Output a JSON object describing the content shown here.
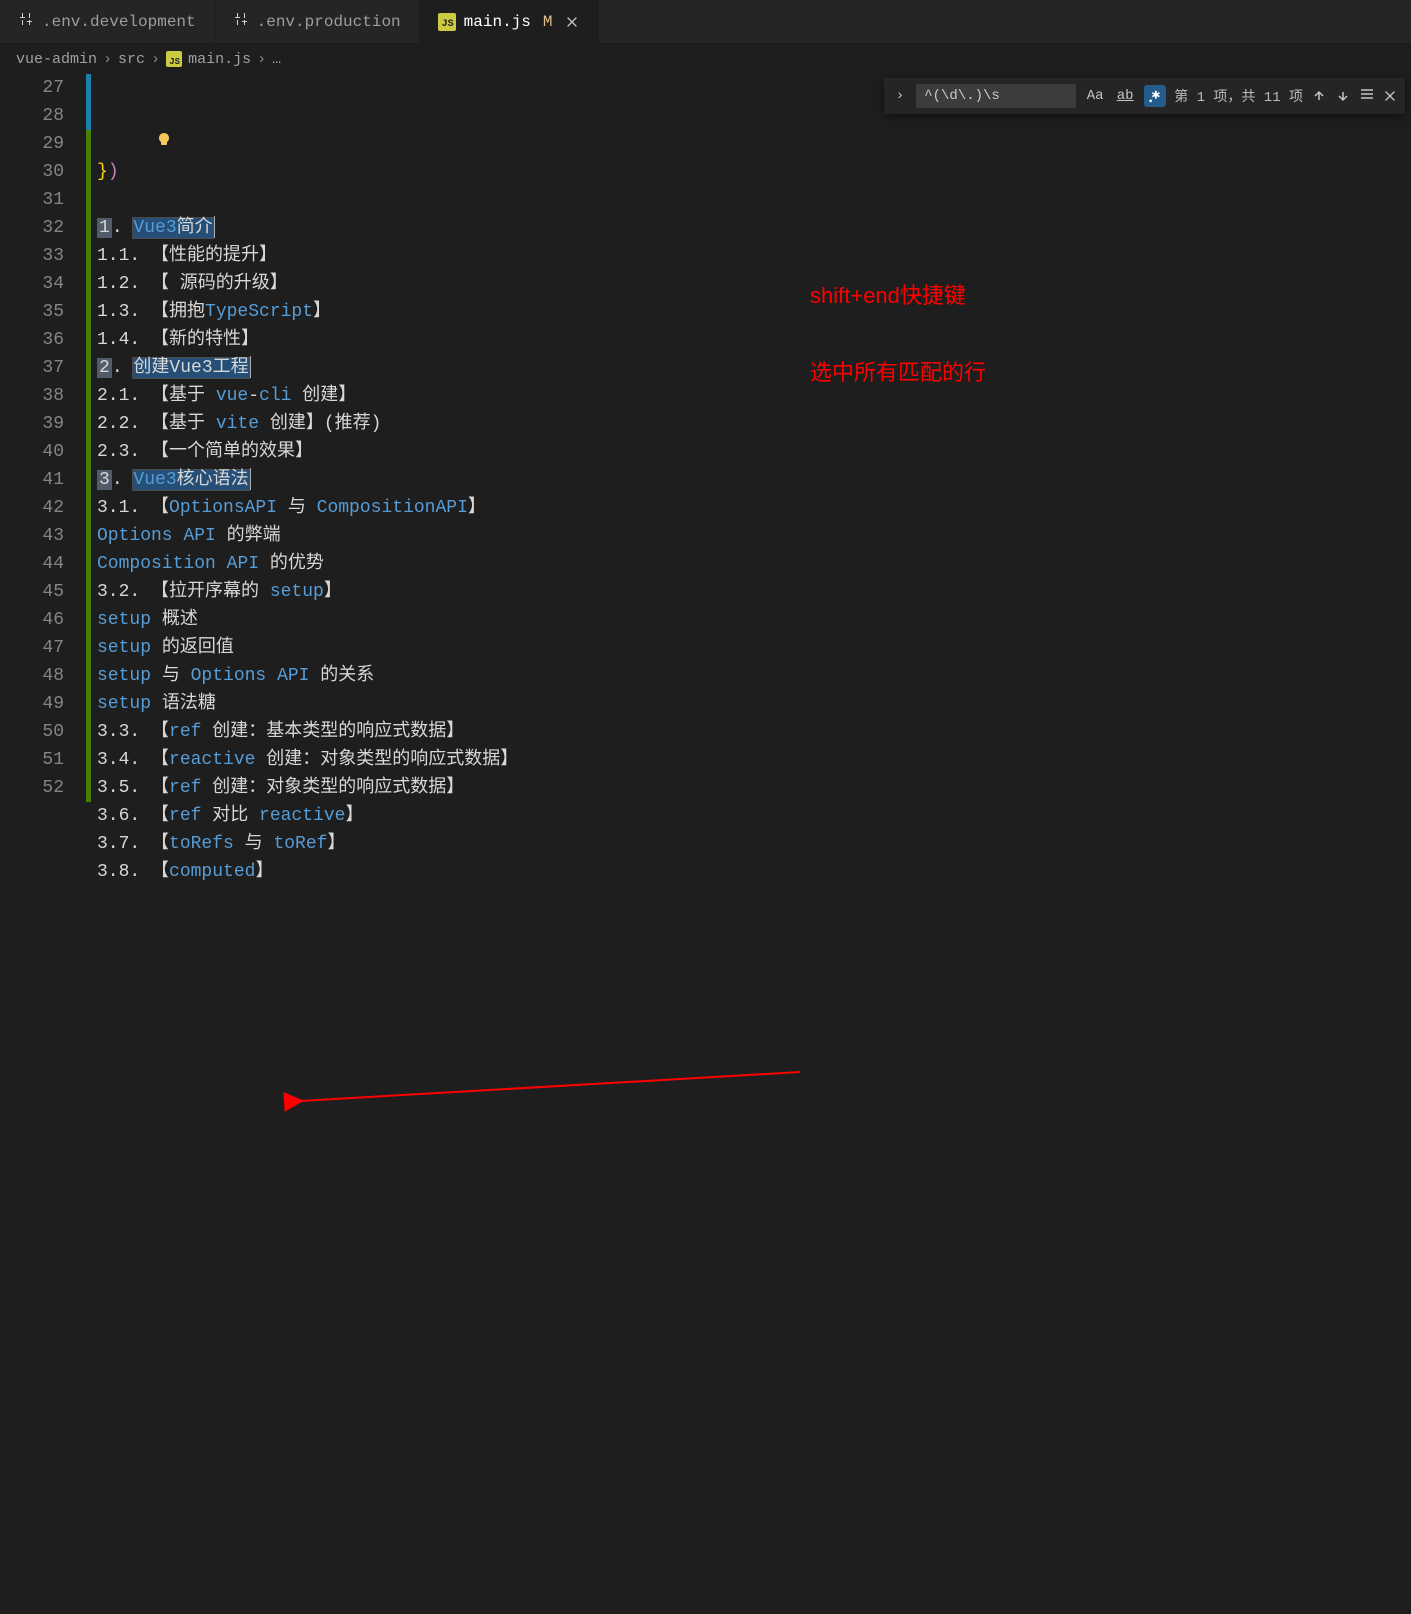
{
  "tabs": [
    {
      "label": ".env.development",
      "icon_name": "settings-icon"
    },
    {
      "label": ".env.production",
      "icon_name": "settings-icon"
    },
    {
      "label": "main.js",
      "icon_name": "js-icon",
      "dirty_mark": "M",
      "active": true
    }
  ],
  "breadcrumbs": {
    "root": "vue-admin",
    "folder": "src",
    "file_badge": "JS",
    "file": "main.js",
    "trailing": "…"
  },
  "find": {
    "value": "^(\\d\\.)\\s",
    "match_case_label": "Aa",
    "whole_word_label": "ab",
    "regex_active": true,
    "results_text": "第 1 项，共 11 项"
  },
  "annotations": {
    "hint1": "shift+end快捷键",
    "hint2": "选中所有匹配的行"
  },
  "code_lines": [
    {
      "n": 27,
      "type": "sym",
      "text": "})"
    },
    {
      "n": 28,
      "type": "blank"
    },
    {
      "n": 29,
      "type": "selhead",
      "num": "1.",
      "rest": "Vue3简介"
    },
    {
      "n": 30,
      "type": "sub",
      "num": "1.1.",
      "rest": "【性能的提升】"
    },
    {
      "n": 31,
      "type": "sub",
      "num": "1.2.",
      "rest": "【 源码的升级】"
    },
    {
      "n": 32,
      "type": "subcode",
      "num": "1.3.",
      "pre": "【拥抱",
      "kw": "TypeScript",
      "post": "】"
    },
    {
      "n": 33,
      "type": "sub",
      "num": "1.4.",
      "rest": "【新的特性】"
    },
    {
      "n": 34,
      "type": "selhead",
      "num": "2.",
      "rest": "创建Vue3工程"
    },
    {
      "n": 35,
      "type": "subcode",
      "num": "2.1.",
      "pre": "【基于 ",
      "kw": "vue",
      "mid": "-",
      "kw2": "cli",
      "post": " 创建】"
    },
    {
      "n": 36,
      "type": "subcode",
      "num": "2.2.",
      "pre": "【基于 ",
      "kw": "vite",
      "post": " 创建】(推荐)"
    },
    {
      "n": 37,
      "type": "sub",
      "num": "2.3.",
      "rest": "【一个简单的效果】"
    },
    {
      "n": 38,
      "type": "selhead",
      "num": "3.",
      "rest": "Vue3核心语法"
    },
    {
      "n": 39,
      "type": "subcode",
      "num": "3.1.",
      "pre": "【",
      "kw": "OptionsAPI",
      "mid": " 与 ",
      "kw2": "CompositionAPI",
      "post": "】"
    },
    {
      "n": 40,
      "type": "kwline",
      "kw": "Options",
      "kw2": "API",
      "post": " 的弊端"
    },
    {
      "n": 41,
      "type": "kwline",
      "kw": "Composition",
      "kw2": "API",
      "post": " 的优势"
    },
    {
      "n": 42,
      "type": "subcode",
      "num": "3.2.",
      "pre": "【拉开序幕的 ",
      "kw": "setup",
      "post": "】"
    },
    {
      "n": 43,
      "type": "kwline",
      "kw": "setup",
      "post": " 概述"
    },
    {
      "n": 44,
      "type": "kwline",
      "kw": "setup",
      "post": " 的返回值"
    },
    {
      "n": 45,
      "type": "kwline3",
      "kw": "setup",
      "mid": " 与 ",
      "kw2": "Options",
      "kw3": "API",
      "post": " 的关系"
    },
    {
      "n": 46,
      "type": "kwline",
      "kw": "setup",
      "post": " 语法糖"
    },
    {
      "n": 47,
      "type": "subcode",
      "num": "3.3.",
      "pre": "【",
      "kw": "ref",
      "post": " 创建：基本类型的响应式数据】"
    },
    {
      "n": 48,
      "type": "subcode",
      "num": "3.4.",
      "pre": "【",
      "kw": "reactive",
      "post": " 创建：对象类型的响应式数据】"
    },
    {
      "n": 49,
      "type": "subcode",
      "num": "3.5.",
      "pre": "【",
      "kw": "ref",
      "post": " 创建：对象类型的响应式数据】"
    },
    {
      "n": 50,
      "type": "subcode",
      "num": "3.6.",
      "pre": "【",
      "kw": "ref",
      "mid": " 对比 ",
      "kw2": "reactive",
      "post": "】"
    },
    {
      "n": 51,
      "type": "subcode",
      "num": "3.7.",
      "pre": "【",
      "kw": "toRefs",
      "mid": " 与 ",
      "kw2": "toRef",
      "post": "】"
    },
    {
      "n": 52,
      "type": "subcode",
      "num": "3.8.",
      "pre": "【",
      "kw": "computed",
      "post": "】"
    }
  ]
}
